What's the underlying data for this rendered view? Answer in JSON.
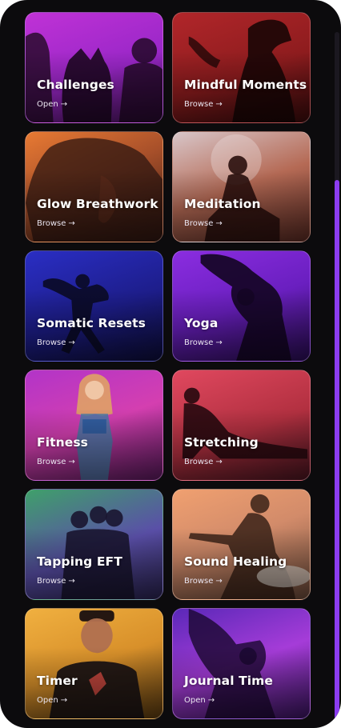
{
  "categories": [
    {
      "title": "Challenges",
      "action": "Open",
      "arrow": "→",
      "accent": "#c032d6"
    },
    {
      "title": "Mindful Moments",
      "action": "Browse",
      "arrow": "→",
      "accent": "#b1262a"
    },
    {
      "title": "Glow Breathwork",
      "action": "Browse",
      "arrow": "→",
      "accent": "#e87a33"
    },
    {
      "title": "Meditation",
      "action": "Browse",
      "arrow": "→",
      "accent": "#d8c6c9"
    },
    {
      "title": "Somatic Resets",
      "action": "Browse",
      "arrow": "→",
      "accent": "#2a2ec4"
    },
    {
      "title": "Yoga",
      "action": "Browse",
      "arrow": "→",
      "accent": "#8b2de0"
    },
    {
      "title": "Fitness",
      "action": "Browse",
      "arrow": "→",
      "accent": "#d43fb0"
    },
    {
      "title": "Stretching",
      "action": "Browse",
      "arrow": "→",
      "accent": "#e0485f"
    },
    {
      "title": "Tapping EFT",
      "action": "Browse",
      "arrow": "→",
      "accent": "#3fa06a"
    },
    {
      "title": "Sound Healing",
      "action": "Browse",
      "arrow": "→",
      "accent": "#f0a070"
    },
    {
      "title": "Timer",
      "action": "Open",
      "arrow": "→",
      "accent": "#f0b040"
    },
    {
      "title": "Journal Time",
      "action": "Open",
      "arrow": "→",
      "accent": "#a53cd8"
    }
  ],
  "theme": {
    "background": "#0c0b0d",
    "scrollbar": "#8b3cf0"
  }
}
